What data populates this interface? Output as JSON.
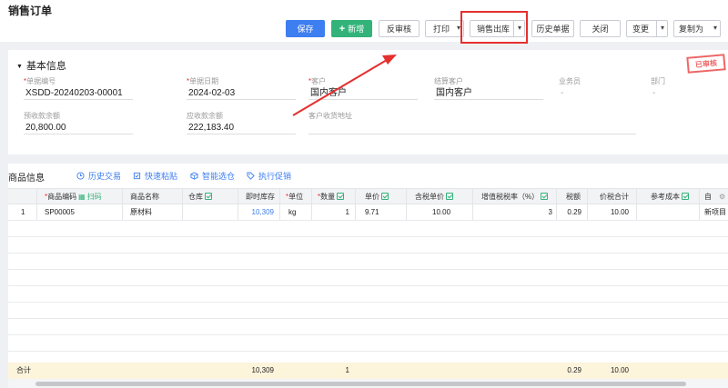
{
  "page": {
    "title": "销售订单"
  },
  "toolbar": {
    "save": "保存",
    "add": "新增",
    "unaudit": "反审核",
    "print": "打印",
    "sales_out": "销售出库",
    "history": "历史单据",
    "close": "关闭",
    "change": "变更",
    "copy_as": "复制为"
  },
  "basic": {
    "title": "基本信息",
    "stamp": "已审核",
    "fields": [
      {
        "label": "单据编号",
        "required": "*",
        "value": "XSDD-20240203-00001"
      },
      {
        "label": "单据日期",
        "required": "*",
        "value": "2024-02-03"
      },
      {
        "label": "客户",
        "required": "*",
        "value": "国内客户"
      },
      {
        "label": "结算客户",
        "required": "",
        "value": "国内客户"
      },
      {
        "label": "业务员",
        "required": "",
        "value": "-"
      },
      {
        "label": "部门",
        "required": "",
        "value": "-"
      },
      {
        "label": "预收款余额",
        "required": "",
        "value": "20,800.00"
      },
      {
        "label": "应收款余额",
        "required": "",
        "value": "222,183.40"
      },
      {
        "label": "客户收货地址",
        "required": "",
        "value": ""
      }
    ]
  },
  "goods": {
    "title": "商品信息",
    "actions": [
      "历史交易",
      "快速粘贴",
      "智能选仓",
      "执行促销"
    ],
    "scan": "扫码",
    "columns": [
      "商品编码",
      "商品名称",
      "仓库",
      "即时库存",
      "单位",
      "数量",
      "单价",
      "含税单价",
      "增值税税率（%）",
      "税额",
      "价税合计",
      "参考成本",
      "自"
    ],
    "rows": [
      {
        "no": "1",
        "code": "SP00005",
        "name": "原材料",
        "warehouse": "",
        "stock": "10,309",
        "unit": "kg",
        "qty": "1",
        "price": "9.71",
        "tax_price": "10.00",
        "tax_rate": "3",
        "tax": "0.29",
        "total": "10.00",
        "cost": "",
        "project": "新项目"
      }
    ],
    "totals": {
      "label": "合计",
      "stock": "10,309",
      "qty": "1",
      "tax": "0.29",
      "total": "10.00"
    }
  },
  "colors": {
    "primary": "#3d7ef0",
    "success": "#33b37a",
    "highlight": "#e53030",
    "totals_bg": "#fdf4dc"
  }
}
